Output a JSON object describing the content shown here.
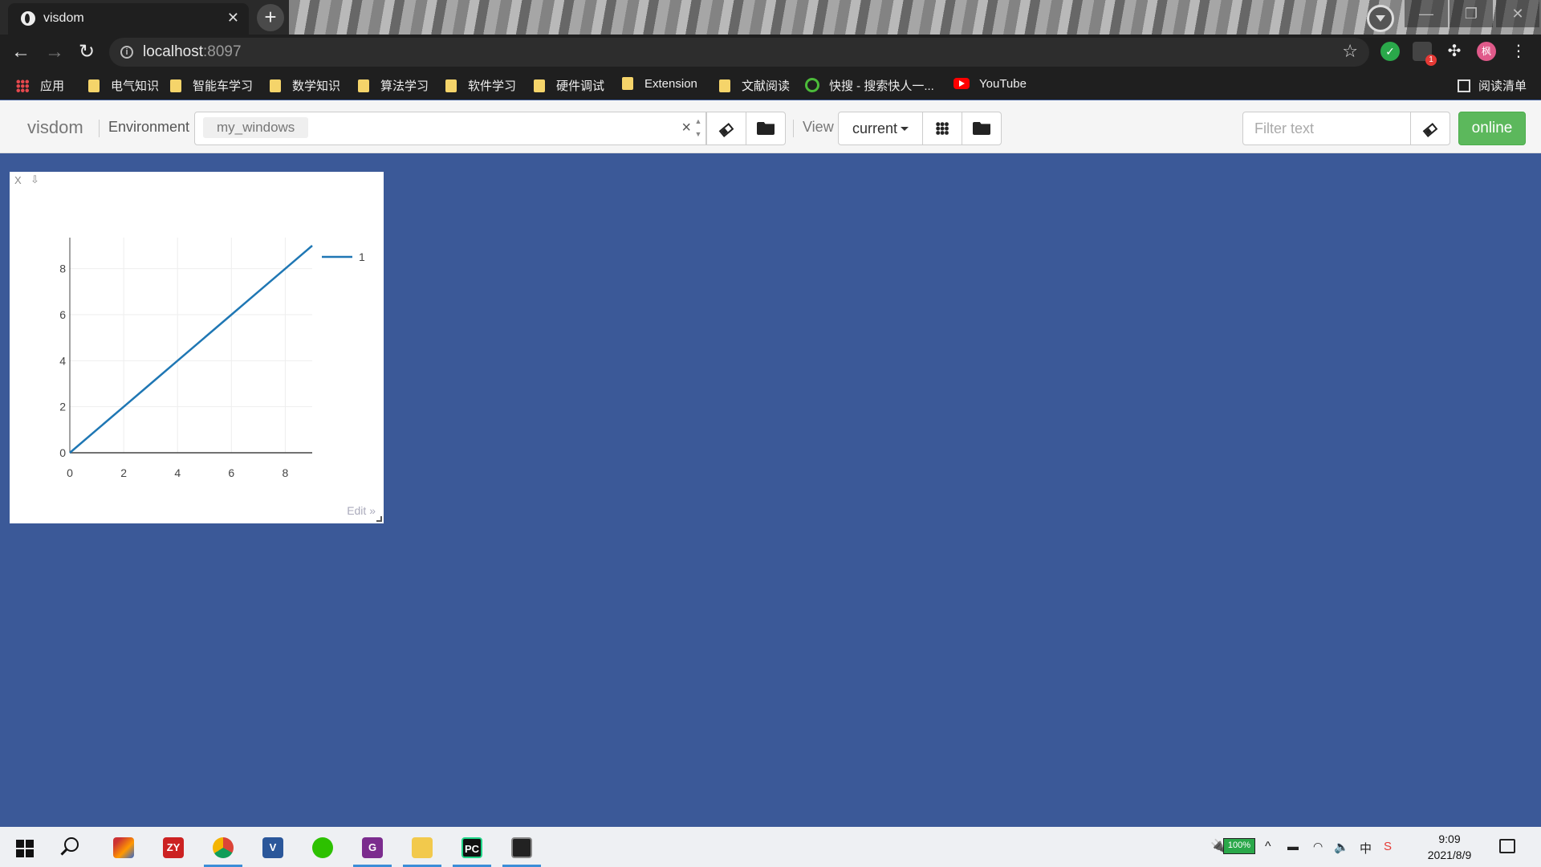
{
  "browser": {
    "tab_title": "visdom",
    "tab_close": "✕",
    "new_tab": "+",
    "url_host": "localhost",
    "url_port": ":8097",
    "ext_badge": "1",
    "profile_initial": "枫"
  },
  "bookmarks": [
    {
      "label": "应用",
      "icon": "apps-icon"
    },
    {
      "label": "电气知识",
      "icon": "folder-icon"
    },
    {
      "label": "智能车学习",
      "icon": "folder-icon"
    },
    {
      "label": "数学知识",
      "icon": "folder-icon"
    },
    {
      "label": "算法学习",
      "icon": "folder-icon"
    },
    {
      "label": "软件学习",
      "icon": "folder-icon"
    },
    {
      "label": "硬件调试",
      "icon": "folder-icon"
    },
    {
      "label": "Extension",
      "icon": "folder-icon"
    },
    {
      "label": "文献阅读",
      "icon": "folder-icon"
    },
    {
      "label": "快搜 - 搜索快人一...",
      "icon": "kuaisou-icon"
    },
    {
      "label": "YouTube",
      "icon": "youtube-icon"
    }
  ],
  "reading_list": "阅读清单",
  "visdom": {
    "brand": "visdom",
    "environment_label": "Environment",
    "environment_chip": "my_windows",
    "env_clear": "×",
    "view_label": "View",
    "view_select": "current",
    "filter_placeholder": "Filter text",
    "online_label": "online"
  },
  "pane": {
    "close": "X",
    "save": "⇩",
    "edit": "Edit »"
  },
  "chart_data": {
    "type": "line",
    "series": [
      {
        "name": "1",
        "x": [
          0,
          1,
          2,
          3,
          4,
          5,
          6,
          7,
          8,
          9
        ],
        "y": [
          0,
          1,
          2,
          3,
          4,
          5,
          6,
          7,
          8,
          9
        ],
        "color": "#1f77b4"
      }
    ],
    "xlim": [
      0,
      9
    ],
    "ylim": [
      0,
      9
    ],
    "xticks": [
      0,
      2,
      4,
      6,
      8
    ],
    "yticks": [
      0,
      2,
      4,
      6,
      8
    ],
    "grid": true,
    "legend": "top-right"
  },
  "taskbar": {
    "battery": "100%",
    "ime": "中",
    "time": "9:09",
    "date": "2021/8/9"
  }
}
